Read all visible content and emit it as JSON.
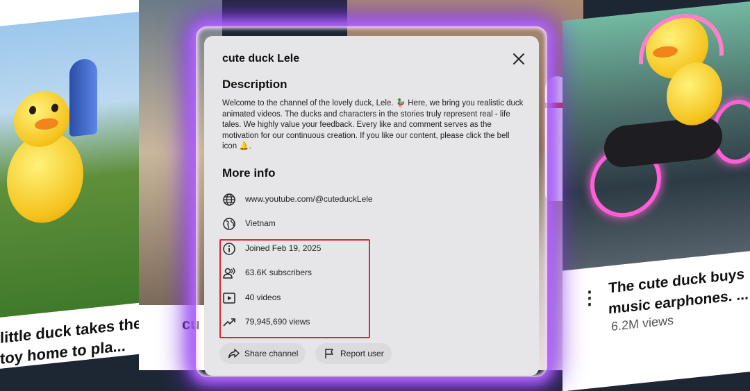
{
  "background": {
    "left_card": {
      "title": "little duck takes the toy home to pla..."
    },
    "mid_card": {
      "title": "cu"
    },
    "right_card": {
      "title": "The cute duck buys music earphones. ...",
      "views": "6.2M views"
    }
  },
  "dialog": {
    "channel_name": "cute duck Lele",
    "description_heading": "Description",
    "description_text": "Welcome to the channel of the lovely duck, Lele. 🦆 Here, we bring you realistic duck animated videos. The ducks and characters in the stories truly represent real - life tales. We highly value your feedback. Every like and comment serves as the motivation for our continuous creation. If you like our content, please click the bell icon 🔔.",
    "more_info_heading": "More info",
    "info": {
      "url": "www.youtube.com/@cuteduckLele",
      "country": "Vietnam",
      "joined": "Joined Feb 19, 2025",
      "subscribers": "63.6K subscribers",
      "videos": "40 videos",
      "views": "79,945,690 views"
    },
    "buttons": {
      "share": "Share channel",
      "report": "Report user"
    }
  },
  "colors": {
    "glow": "#9b4dff",
    "highlight": "#d32a38",
    "dialog_bg": "#e6e6e9"
  },
  "icons": [
    "globe-icon",
    "location-globe-icon",
    "info-icon",
    "subscribers-icon",
    "video-icon",
    "trending-icon",
    "share-icon",
    "flag-icon",
    "close-icon"
  ]
}
